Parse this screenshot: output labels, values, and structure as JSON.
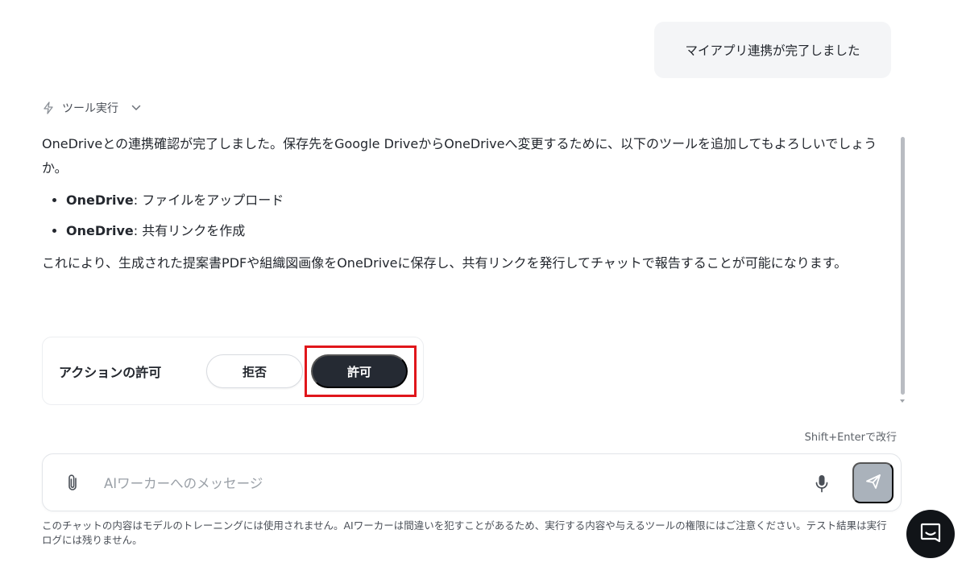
{
  "user_message": "マイアプリ連携が完了しました",
  "tool_exec": {
    "label": "ツール実行"
  },
  "assistant": {
    "paragraph1": "OneDriveとの連携確認が完了しました。保存先をGoogle DriveからOneDriveへ変更するために、以下のツールを追加してもよろしいでしょうか。",
    "tools": [
      {
        "name": "OneDrive",
        "desc": ": ファイルをアップロード"
      },
      {
        "name": "OneDrive",
        "desc": ": 共有リンクを作成"
      }
    ],
    "paragraph2": "これにより、生成された提案書PDFや組織図画像をOneDriveに保存し、共有リンクを発行してチャットで報告することが可能になります。"
  },
  "action": {
    "label": "アクションの許可",
    "deny_label": "拒否",
    "allow_label": "許可"
  },
  "composer": {
    "hint": "Shift+Enterで改行",
    "placeholder": "AIワーカーへのメッセージ"
  },
  "disclaimer": "このチャットの内容はモデルのトレーニングには使用されません。AIワーカーは間違いを犯すことがあるため、実行する内容や与えるツールの権限にはご注意ください。テスト結果は実行ログには残りません。",
  "colors": {
    "primary_button": "#252a33",
    "highlight_border": "#e0161b",
    "send_button": "#aab2bb",
    "user_bubble": "#f4f5f7"
  },
  "icons": [
    "lightning-icon",
    "chevron-down-icon",
    "paperclip-icon",
    "microphone-icon",
    "send-icon",
    "chat-icon"
  ]
}
